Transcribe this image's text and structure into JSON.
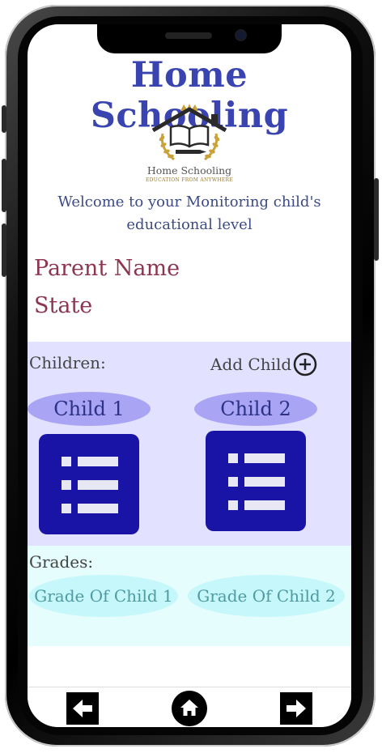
{
  "app": {
    "title": "Home Schooling",
    "logo_text": "Home Schooling",
    "logo_subtext": "EDUCATION FROM ANYWHERE",
    "welcome": "Welcome to your Monitoring child's educational level"
  },
  "parent": {
    "name_label": "Parent Name",
    "state_label": "State"
  },
  "children": {
    "label": "Children:",
    "add_label": "Add Child",
    "items": [
      {
        "name": "Child 1"
      },
      {
        "name": "Child 2"
      }
    ]
  },
  "grades": {
    "label": "Grades:",
    "items": [
      {
        "label": "Grade Of Child 1"
      },
      {
        "label": "Grade Of Child 2"
      }
    ]
  },
  "nav": {
    "icons": [
      "arrow-left-icon",
      "home-icon",
      "arrow-right-icon"
    ]
  },
  "colors": {
    "title": "#3a44b0",
    "parent_text": "#8c3550",
    "children_bg": "#e2e1ff",
    "child_pill": "#a9a4f3",
    "child_card": "#1a14a6",
    "grades_bg": "#e5fdfd",
    "grade_pill": "#c5f7fb"
  }
}
